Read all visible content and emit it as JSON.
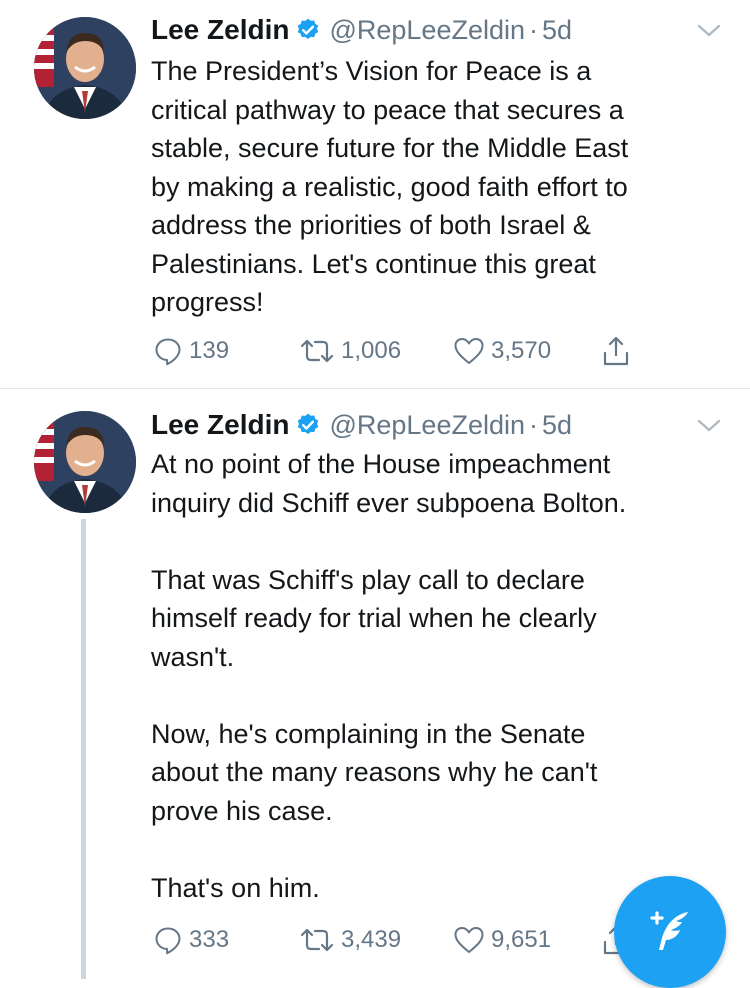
{
  "tweets": [
    {
      "author": {
        "name": "Lee Zeldin",
        "handle": "@RepLeeZeldin",
        "time": "5d",
        "separator": "·"
      },
      "text": "The President’s Vision for Peace is a\ncritical pathway to peace that secures a\nstable, secure future for the Middle East\nby making a realistic, good faith effort to\naddress the priorities of both Israel &\nPalestinians. Let's continue this great\nprogress!",
      "stats": {
        "replies": "139",
        "retweets": "1,006",
        "likes": "3,570"
      }
    },
    {
      "author": {
        "name": "Lee Zeldin",
        "handle": "@RepLeeZeldin",
        "time": "5d",
        "separator": "·"
      },
      "text": "At no point of the House impeachment\ninquiry did Schiff ever subpoena Bolton.\n\nThat was Schiff's play call to declare\nhimself ready for trial when he clearly\nwasn't.\n\nNow, he's complaining in the Senate\nabout the many reasons why he can't\nprove his case.\n\nThat's on him.",
      "stats": {
        "replies": "333",
        "retweets": "3,439",
        "likes": "9,651"
      }
    }
  ],
  "icons": {
    "verified": "verified-badge-icon",
    "caret": "chevron-down-icon",
    "reply": "reply-icon",
    "retweet": "retweet-icon",
    "like": "heart-icon",
    "share": "share-icon",
    "compose": "compose-tweet-icon"
  },
  "colors": {
    "accent": "#1da1f2",
    "muted": "#657786",
    "text": "#14171a",
    "divider": "#e1e8ed"
  }
}
